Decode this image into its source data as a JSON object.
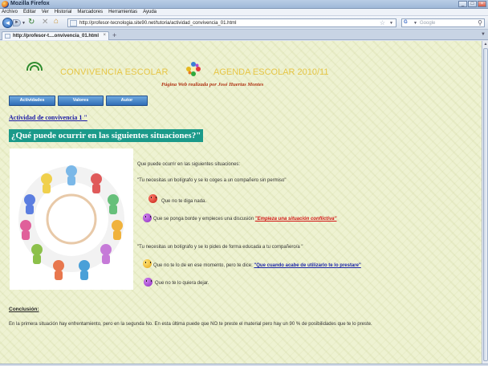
{
  "window": {
    "title": "Mozilla Firefox"
  },
  "menubar": [
    "Archivo",
    "Editar",
    "Ver",
    "Historial",
    "Marcadores",
    "Herramientas",
    "Ayuda"
  ],
  "navbar": {
    "url": "http://profesor-tecnologia.site90.net/tutoria/actividad_convivencia_01.html",
    "search_engine": "Google"
  },
  "tab": {
    "label": "http://profesor-t....onvivencia_01.html"
  },
  "page": {
    "banner_left": "CONVIVENCIA ESCOLAR",
    "banner_right": "AGENDA   ESCOLAR  2010/11",
    "subtitle": "Página Web realizada por José Huertas Montes",
    "nav_buttons": [
      "Actividades",
      "Valores",
      "Autor"
    ],
    "activity_link": "Actividad de convivencia 1 \"",
    "question": "¿Qué puede ocurrir en las siguientes situaciones?\"",
    "intro": "Que puede ocurrir en las siguientes situaciones:",
    "case1": "\"Tu necesitas un bolígrafo y se lo coges a un compañero sin permiso\"",
    "opt1": "Que no te diga nada.",
    "opt2_prefix": "Que se ponga borde y empieces una discusión",
    "opt2_link": "\"Empieza una situación  conflictiva\"",
    "case2": "\"Tu necesitas un bolígrafo y se lo pides de forma educada a tu compañero/a \"",
    "opt3_prefix": "Que no te lo de en ese momento, pero te dice:",
    "opt3_link": "\"Que cuando acabe de  utilizarlo te lo  prestare\"",
    "opt4": "Que no te lo quiera dejar.",
    "conclusion_heading": "Conclusión:",
    "conclusion_text": "En la primera situación hay enfrentamiento, pero en la segunda No. En esta última puede que  NO  te preste  el  material pero hay un 90 % de  posibilidades  que  te lo preste."
  }
}
